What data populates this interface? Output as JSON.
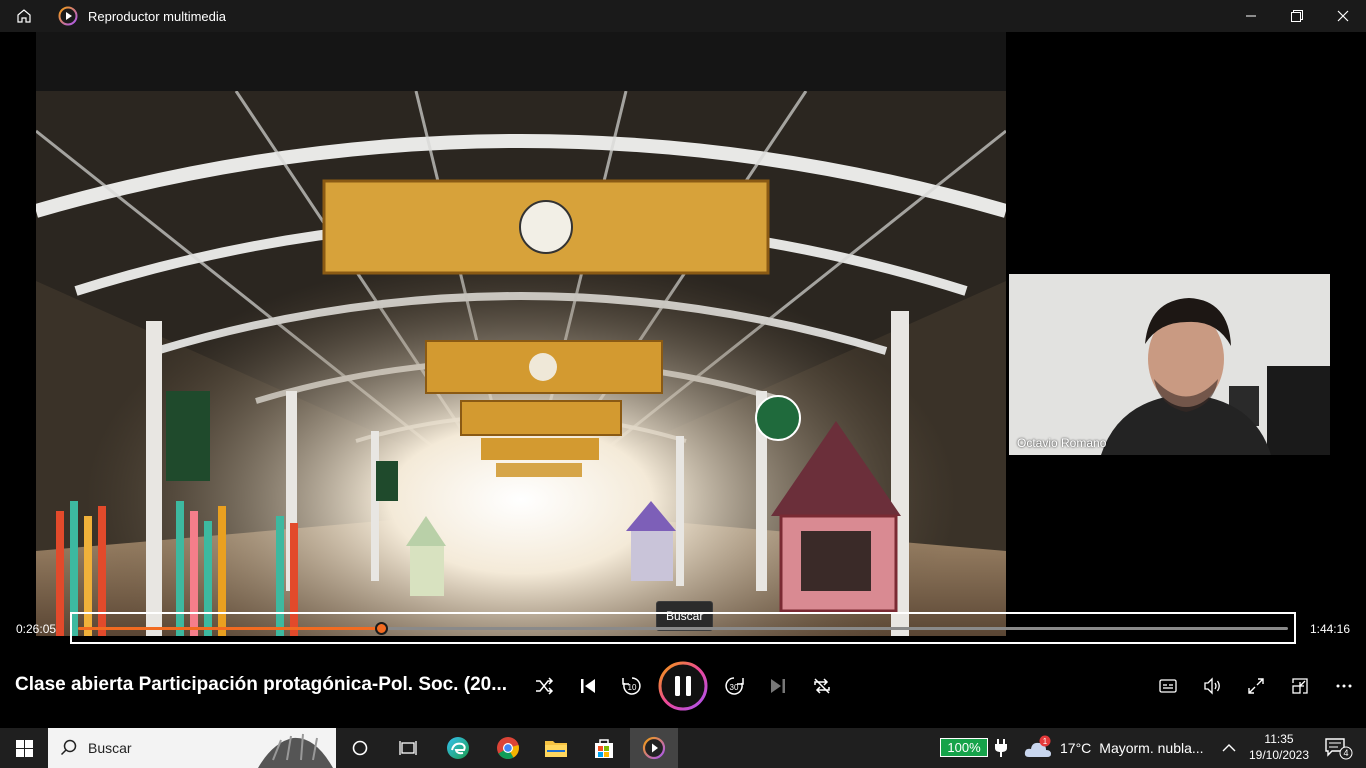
{
  "window": {
    "title": "Reproductor multimedia"
  },
  "video": {
    "webcam_name": "Octavio Romano",
    "tooltip": "Buscar"
  },
  "seek": {
    "current_time": "0:26:05",
    "total_time": "1:44:16",
    "progress": 0.25
  },
  "controls": {
    "media_title": "Clase abierta Participación protagónica-Pol. Soc. (20...",
    "skip_back_label": "10",
    "skip_forward_label": "30",
    "accent_color": "#f26b21"
  },
  "taskbar": {
    "search_placeholder": "Buscar",
    "battery": "100%",
    "weather_badge": "1",
    "temperature": "17°C",
    "weather_text": "Mayorm. nubla...",
    "time": "11:35",
    "date": "19/10/2023",
    "notifications": "4"
  }
}
